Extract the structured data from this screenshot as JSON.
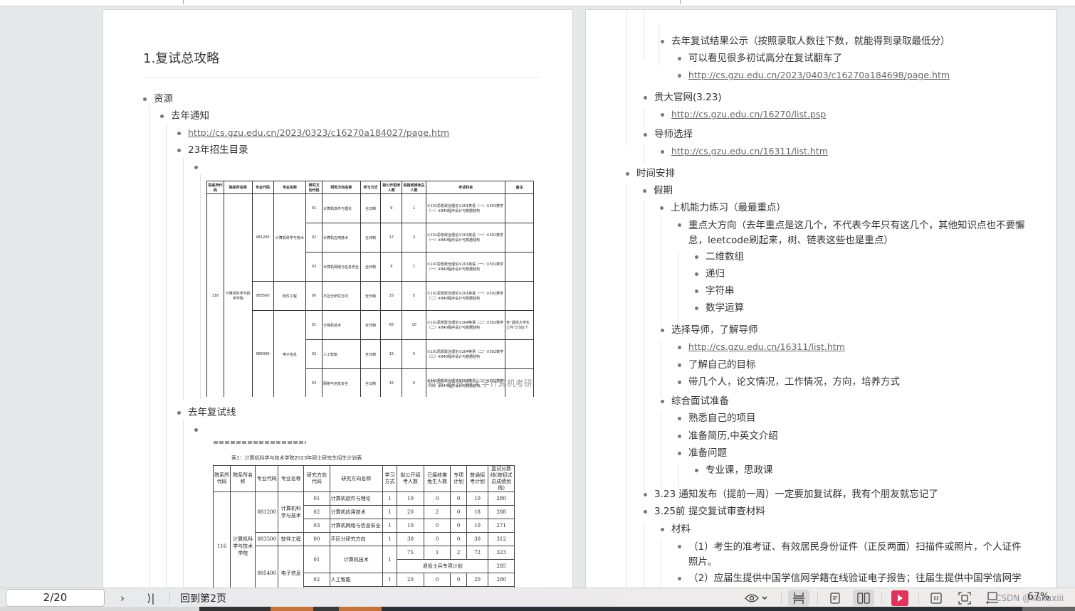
{
  "viewer": {
    "page_indicator": "2/20",
    "goto_label": "回到第2页",
    "zoom_level": "67%",
    "watermark_credit": "CSDN @Kakaxiii"
  },
  "toolbar": {
    "icons": [
      "eye-icon",
      "chevron-down-icon",
      "continuous-scroll-icon",
      "single-page-icon",
      "two-page-icon",
      "play-icon",
      "fit-page-icon",
      "fullscreen-icon",
      "rotate-icon"
    ],
    "next_label": "›",
    "last_label": "⟩|",
    "play_color": "#e0325a"
  },
  "left_page": {
    "heading": "1.复试总攻略",
    "resources": "资源",
    "last_year_notice": "去年通知",
    "notice_link": "http://cs.gzu.edu.cn/2023/0323/c16270a184027/page.htm",
    "catalog_23": "23年招生目录",
    "last_year_line": "去年复试线",
    "table1": {
      "headers": [
        "院系所代码",
        "院系所名称",
        "专业代码",
        "专业名称",
        "研究方向代码",
        "研究方向名称",
        "学习方式",
        "拟公开招考人数",
        "拟接收推免生人数",
        "考试科目",
        "备注"
      ],
      "dept_code": "116",
      "dept_name": "计算机科学与技术学院",
      "rows": [
        {
          "major_code": "081200",
          "major": "计算机科学与技术",
          "dir_code": "01",
          "dir": "计算机软件与理论",
          "mode": "全日制",
          "open": "9",
          "rec": "1",
          "exam": "①101思想政治理论②201英语（一）③301数学（一）④840程序设计与数据结构",
          "note": ""
        },
        {
          "major_code": "",
          "major": "",
          "dir_code": "02",
          "dir": "计算机应用技术",
          "mode": "全日制",
          "open": "17",
          "rec": "3",
          "exam": "①101思想政治理论②201英语（一）③301数学（一）④840程序设计与数据结构",
          "note": ""
        },
        {
          "major_code": "",
          "major": "",
          "dir_code": "03",
          "dir": "计算机网络与信息安全",
          "mode": "全日制",
          "open": "9",
          "rec": "1",
          "exam": "①101思想政治理论②201英语（一）③301数学（一）④840程序设计与数据结构",
          "note": ""
        },
        {
          "major_code": "083500",
          "major": "软件工程",
          "dir_code": "00",
          "dir": "不区分研究方向",
          "mode": "全日制",
          "open": "25",
          "rec": "5",
          "exam": "①101思想政治理论②201英语（一）③302数学（二）④840程序设计与数据结构",
          "note": ""
        },
        {
          "major_code": "085400",
          "major": "电子信息",
          "dir_code": "01",
          "dir": "计算机技术",
          "mode": "全日制",
          "open": "65",
          "rec": "10",
          "exam": "①101思想政治理论②204英语（二）③302数学（二）④840程序设计与数据结构",
          "note": "含“退役大学生士兵”计划2个"
        },
        {
          "major_code": "",
          "major": "",
          "dir_code": "02",
          "dir": "人工智能",
          "mode": "全日制",
          "open": "15",
          "rec": "5",
          "exam": "①101思想政治理论②204英语（二）③302数学（二）④840程序设计与数据结构",
          "note": ""
        },
        {
          "major_code": "",
          "major": "",
          "dir_code": "03",
          "dir": "网络与信息安全",
          "mode": "全日制",
          "open": "15",
          "rec": "5",
          "exam": "①101思想政治理论②204英语（二）③302数学（二）④840程序设计与数据结构",
          "note": ""
        }
      ],
      "watermark": "知乎 @贵州大学计算机考研"
    },
    "table2": {
      "caption": "表1：计算机科学与技术学院2023年硕士研究生招生计划表",
      "headers": [
        "院系所代码",
        "院系所名称",
        "专业代码",
        "专业名称",
        "研究方向代码",
        "研究方向名称",
        "学习方式",
        "拟公开招考人数",
        "已接收推免生人数",
        "专项计划",
        "普通招考计划",
        "复试分数线(按初试总成绩划线)"
      ],
      "dept_code": "116",
      "dept_name": "计算机科学与技术学院",
      "rows": [
        {
          "major_code": "081200",
          "major": "计算机科学与技术",
          "dir_code": "01",
          "dir": "计算机软件与理论",
          "mode": "1",
          "open": "10",
          "rec": "0",
          "special": "0",
          "plan": "10",
          "line": "280"
        },
        {
          "dir_code": "02",
          "dir": "计算机应用技术",
          "mode": "1",
          "open": "20",
          "rec": "2",
          "special": "0",
          "plan": "18",
          "line": "288"
        },
        {
          "dir_code": "03",
          "dir": "计算机网络与信息安全",
          "mode": "1",
          "open": "10",
          "rec": "0",
          "special": "0",
          "plan": "10",
          "line": "271"
        },
        {
          "major_code": "083500",
          "major": "软件工程",
          "dir_code": "00",
          "dir": "不区分研究方向",
          "mode": "1",
          "open": "30",
          "rec": "0",
          "special": "0",
          "plan": "30",
          "line": "312"
        },
        {
          "major_code": "085400",
          "major": "电子信息",
          "dir_code": "01",
          "dir": "计算机技术",
          "mode": "1",
          "open": "75",
          "rec": "1",
          "special": "2",
          "plan": "72",
          "line": "323"
        },
        {
          "veteran_label": "退役士兵专项计划",
          "line": "285"
        },
        {
          "dir_code": "02",
          "dir": "人工智能",
          "mode": "1",
          "open": "20",
          "rec": "0",
          "special": "0",
          "plan": "20",
          "line": "280"
        }
      ]
    }
  },
  "right_page": {
    "results_pub": "去年复试结果公示（按照录取人数往下数，就能得到录取最低分）",
    "results_note": "可以看见很多初试高分在复试翻车了",
    "results_link": "http://cs.gzu.edu.cn/2023/0403/c16270a184698/page.htm",
    "official_site": "贵大官网(3.23)",
    "official_link": "http://cs.gzu.edu.cn/16270/list.psp",
    "advisor_select": "导师选择",
    "advisor_link": "http://cs.gzu.edu.cn/16311/list.htm",
    "schedule": "时间安排",
    "holiday": "假期",
    "coding_practice": "上机能力练习（最最重点）",
    "focus": "重点大方向（去年重点是这几个，不代表今年只有这几个，其他知识点也不要懈怠，leetcode刷起来，树、链表这些也是重点）",
    "topics": [
      "二维数组",
      "递归",
      "字符串",
      "数学运算"
    ],
    "choose_advisor": "选择导师，了解导师",
    "choose_advisor_link": "http://cs.gzu.edu.cn/16311/list.htm",
    "know_goal": "了解自己的目标",
    "advisor_info": "带几个人，论文情况，工作情况，方向，培养方式",
    "interview_prep": "综合面试准备",
    "interview_items": [
      "熟悉自己的项目",
      "准备简历,中英文介绍",
      "准备问题"
    ],
    "questions_sub": "专业课，思政课",
    "notice_323": "3.23 通知发布（提前一周）一定要加复试群，我有个朋友就忘记了",
    "before_325": "3.25前 提交复试审查材料",
    "materials": "材料",
    "material_1": "（1）考生的准考证、有效居民身份证件（正反两面）扫描件或照片，个人证件照片。",
    "material_2": "（2）应届生提供中国学信网学籍在线验证电子报告；往届生提供中国学信网学"
  }
}
